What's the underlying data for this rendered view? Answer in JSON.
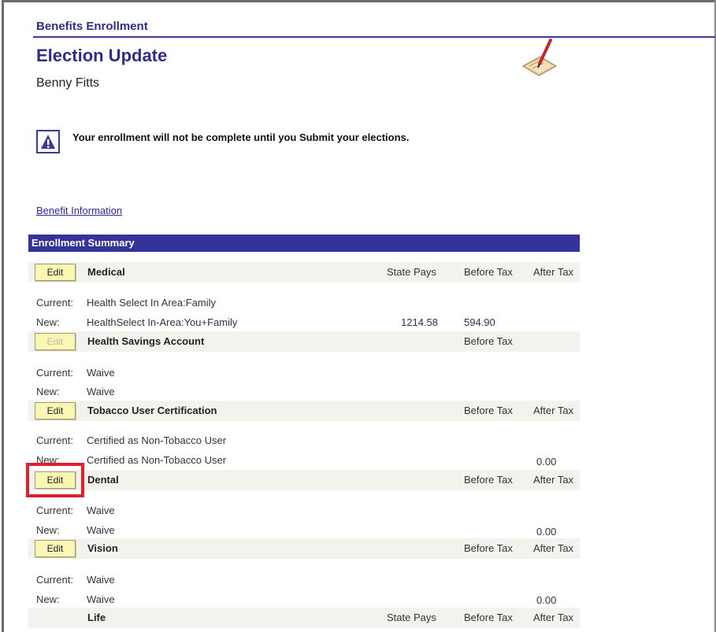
{
  "header": {
    "breadcrumb": "Benefits Enrollment",
    "title": "Election Update",
    "employee_name": "Benny Fitts"
  },
  "notice": {
    "icon": "warning-icon",
    "text": "Your enrollment will not be complete until you Submit your elections."
  },
  "links": {
    "benefit_information": "Benefit Information"
  },
  "summary": {
    "title": "Enrollment Summary",
    "edit_label": "Edit",
    "labels": {
      "current": "Current:",
      "new": "New:"
    },
    "columns": {
      "state_pays": "State Pays",
      "before_tax": "Before Tax",
      "after_tax": "After Tax"
    },
    "medical": {
      "title": "Medical",
      "current": "Health Select In Area:Family",
      "new": "HealthSelect In-Area:You+Family",
      "state_pays": "1214.58",
      "before_tax": "594.90"
    },
    "hsa": {
      "title": "Health Savings Account",
      "current": "Waive",
      "new": "Waive"
    },
    "tobacco": {
      "title": "Tobacco User Certification",
      "current": "Certified as Non-Tobacco User",
      "new": "Certified as Non-Tobacco User",
      "after_tax": "0.00"
    },
    "dental": {
      "title": "Dental",
      "current": "Waive",
      "new": "Waive",
      "after_tax": "0.00"
    },
    "vision": {
      "title": "Vision",
      "current": "Waive",
      "new": "Waive",
      "after_tax": "0.00"
    },
    "life": {
      "title": "Life"
    }
  },
  "colors": {
    "brand": "#2d2e8c",
    "summary_bar": "#33339a",
    "edit_button": "#fbf6b4",
    "highlight": "#e0202a"
  }
}
